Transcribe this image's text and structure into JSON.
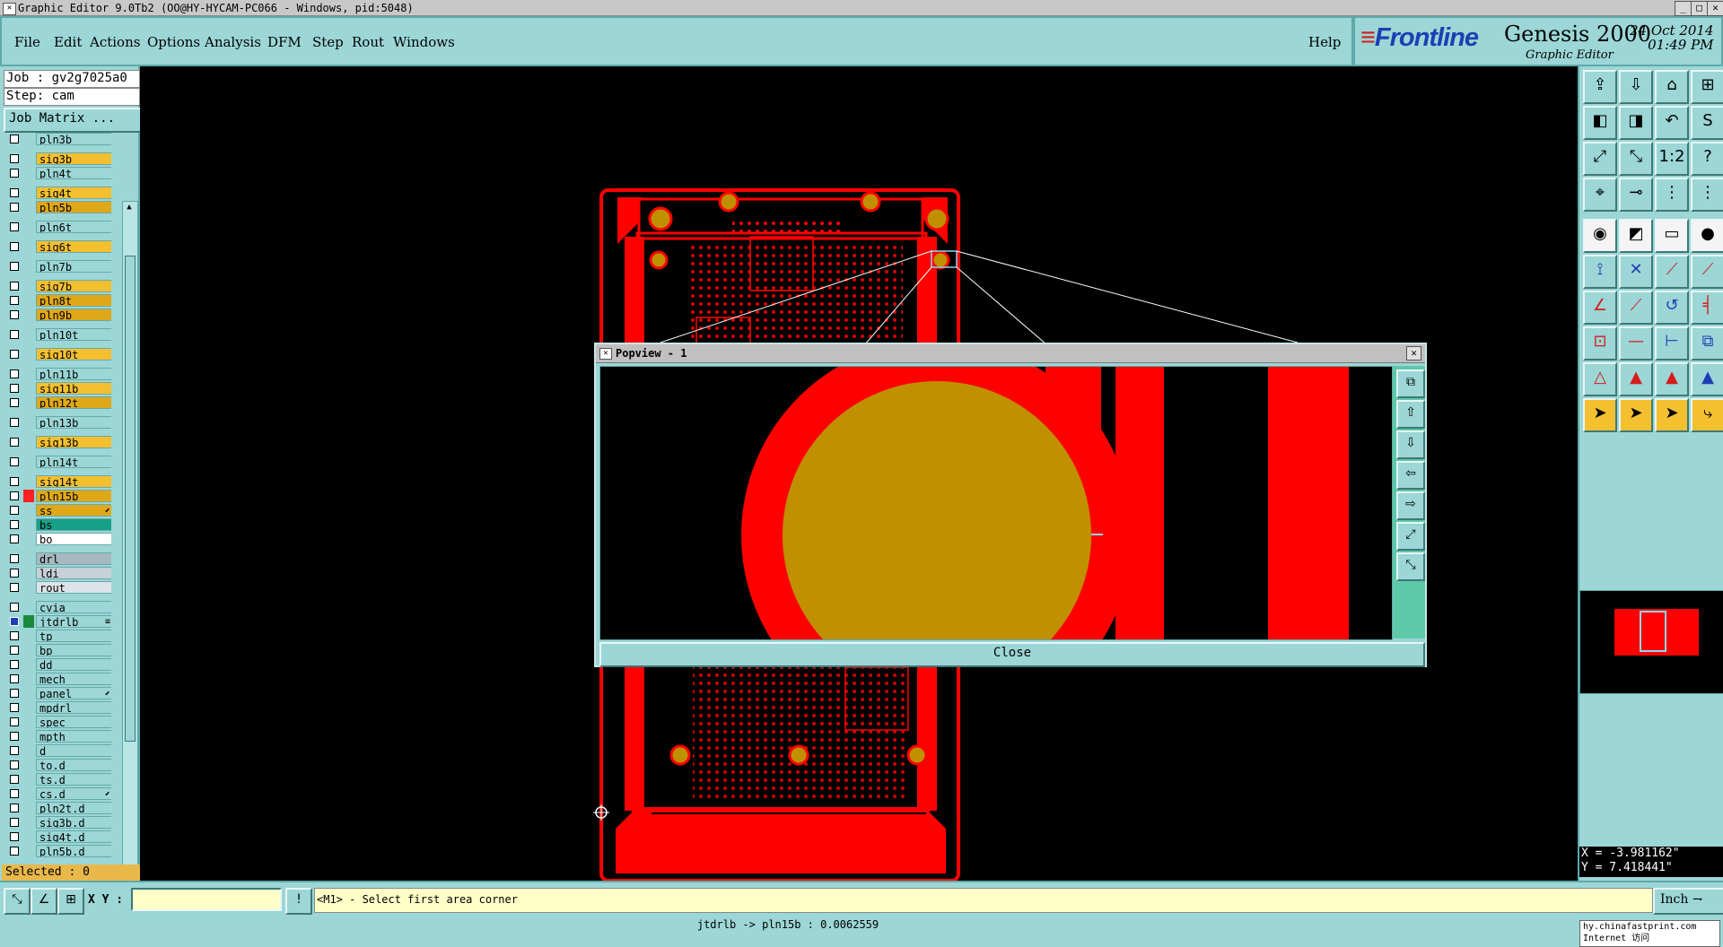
{
  "window": {
    "title": "Graphic Editor 9.0Tb2 (OO@HY-HYCAM-PC066 - Windows, pid:5048)",
    "app_icon": "app-window-icon",
    "controls": [
      "_",
      "□",
      "✕"
    ]
  },
  "menu": [
    "File",
    "Edit",
    "Actions",
    "Options",
    "Analysis",
    "DFM",
    "Step",
    "Rout",
    "Windows"
  ],
  "help_label": "Help",
  "brand": {
    "logo": "Frontline",
    "product": "Genesis 2000",
    "subtitle": "Graphic Editor",
    "date": "24 Oct 2014",
    "time": "01:49 PM",
    "logo_color": "#1d3fb3",
    "accent_color": "#d51b1b"
  },
  "job": {
    "job_label": "Job : gv2g7025a0",
    "step_label": "Step: cam",
    "matrix_button": "Job Matrix ..."
  },
  "layers": [
    {
      "name": "pln3b",
      "color": "#9cd6d6"
    },
    {
      "name": "sig3b",
      "color": "#f4c030"
    },
    {
      "name": "pln4t",
      "color": "#9cd6d6"
    },
    {
      "name": "sig4t",
      "color": "#f4c030"
    },
    {
      "name": "pln5b",
      "color": "#e0a818"
    },
    {
      "name": "pln6t",
      "color": "#9cd6d6"
    },
    {
      "name": "sig6t",
      "color": "#f4c030"
    },
    {
      "name": "pln7b",
      "color": "#9cd6d6"
    },
    {
      "name": "sig7b",
      "color": "#f4c030"
    },
    {
      "name": "pln8t",
      "color": "#e0a818"
    },
    {
      "name": "pln9b",
      "color": "#e0a818"
    },
    {
      "name": "pln10t",
      "color": "#9cd6d6"
    },
    {
      "name": "sig10t",
      "color": "#f4c030"
    },
    {
      "name": "pln11b",
      "color": "#9cd6d6"
    },
    {
      "name": "sig11b",
      "color": "#f4c030"
    },
    {
      "name": "pln12t",
      "color": "#e0a818"
    },
    {
      "name": "pln13b",
      "color": "#9cd6d6"
    },
    {
      "name": "sig13b",
      "color": "#f4c030"
    },
    {
      "name": "pln14t",
      "color": "#9cd6d6"
    },
    {
      "name": "sig14t",
      "color": "#f4c030"
    },
    {
      "name": "pln15b",
      "color": "#e0a818",
      "swatch": "#ff2020"
    },
    {
      "name": "ss",
      "color": "#e0a818",
      "mark": "⬋"
    },
    {
      "name": "bs",
      "color": "#16a088"
    },
    {
      "name": "bo",
      "color": "#ffffff"
    },
    {
      "name": "drl",
      "color": "#a8b8c0"
    },
    {
      "name": "ldi",
      "color": "#c8d0d8"
    },
    {
      "name": "rout",
      "color": "#dde4e8"
    },
    {
      "name": "cvia",
      "color": "#9cd6d6"
    },
    {
      "name": "jtdrlb",
      "color": "#9cd6d6",
      "swatch": "#1a8a3a",
      "checked": true,
      "mark": "≡"
    },
    {
      "name": "tp",
      "color": "#9cd6d6"
    },
    {
      "name": "bp",
      "color": "#9cd6d6"
    },
    {
      "name": "dd",
      "color": "#9cd6d6"
    },
    {
      "name": "mech",
      "color": "#9cd6d6"
    },
    {
      "name": "panel",
      "color": "#9cd6d6",
      "mark": "⬋"
    },
    {
      "name": "mpdrl",
      "color": "#9cd6d6"
    },
    {
      "name": "spec",
      "color": "#9cd6d6"
    },
    {
      "name": "mpth",
      "color": "#9cd6d6"
    },
    {
      "name": "d",
      "color": "#9cd6d6"
    },
    {
      "name": "to.d",
      "color": "#9cd6d6"
    },
    {
      "name": "ts.d",
      "color": "#9cd6d6"
    },
    {
      "name": "cs.d",
      "color": "#9cd6d6",
      "mark": "⬋"
    },
    {
      "name": "pln2t.d",
      "color": "#9cd6d6"
    },
    {
      "name": "sig3b.d",
      "color": "#9cd6d6"
    },
    {
      "name": "sig4t.d",
      "color": "#9cd6d6"
    },
    {
      "name": "pln5b.d",
      "color": "#9cd6d6"
    }
  ],
  "selected_label": "Selected : 0",
  "toolbar": [
    {
      "icon": "open-job-icon",
      "glyph": "⇪"
    },
    {
      "icon": "save-icon",
      "glyph": "⇩"
    },
    {
      "icon": "home-icon",
      "glyph": "⌂"
    },
    {
      "icon": "split-view-icon",
      "glyph": "⊞"
    },
    {
      "icon": "pan-left-icon",
      "glyph": "◧"
    },
    {
      "icon": "pan-right-icon",
      "glyph": "◨"
    },
    {
      "icon": "undo-view-icon",
      "glyph": "↶"
    },
    {
      "icon": "redraw-icon",
      "glyph": "S"
    },
    {
      "icon": "zoom-fit-icon",
      "glyph": "⤢"
    },
    {
      "icon": "zoom-area-icon",
      "glyph": "⤡"
    },
    {
      "icon": "scale-1-2-icon",
      "glyph": "1:2"
    },
    {
      "icon": "help-query-icon",
      "glyph": "?"
    },
    {
      "icon": "measure-icon",
      "glyph": "⌖"
    },
    {
      "icon": "probe-icon",
      "glyph": "⊸"
    },
    {
      "icon": "layer-select-icon",
      "glyph": "⋮"
    },
    {
      "icon": "layer-adjust-icon",
      "glyph": "⋮"
    },
    {
      "icon": "add-pad-icon",
      "glyph": "◉"
    },
    {
      "icon": "add-line-icon",
      "glyph": "◩"
    },
    {
      "icon": "add-text-icon",
      "glyph": "▭"
    },
    {
      "icon": "add-circle-icon",
      "glyph": "●"
    },
    {
      "icon": "connect-icon",
      "glyph": "⟟"
    },
    {
      "icon": "move-node-icon",
      "glyph": "✕"
    },
    {
      "icon": "move-segment-icon",
      "glyph": "⟋"
    },
    {
      "icon": "route-icon",
      "glyph": "⟋"
    },
    {
      "icon": "draw-line-icon",
      "glyph": "∠"
    },
    {
      "icon": "slant-line-icon",
      "glyph": "⟋"
    },
    {
      "icon": "arc-icon",
      "glyph": "↺"
    },
    {
      "icon": "mirror-icon",
      "glyph": "╡"
    },
    {
      "icon": "snap-pad-icon",
      "glyph": "⊡"
    },
    {
      "icon": "cut-line-icon",
      "glyph": "—"
    },
    {
      "icon": "resize-icon",
      "glyph": "⊢"
    },
    {
      "icon": "copy-feature-icon",
      "glyph": "⧉"
    },
    {
      "icon": "triangle-a-icon",
      "glyph": "△"
    },
    {
      "icon": "triangle-b-icon",
      "glyph": "▲"
    },
    {
      "icon": "triangle-c-icon",
      "glyph": "▲"
    },
    {
      "icon": "triangle-d-icon",
      "glyph": "▲"
    },
    {
      "icon": "select-arrow-icon",
      "glyph": "➤"
    },
    {
      "icon": "select-feature-icon",
      "glyph": "➤"
    },
    {
      "icon": "select-net-icon",
      "glyph": "➤"
    },
    {
      "icon": "select-route-icon",
      "glyph": "⤷"
    }
  ],
  "readout": {
    "x": "X = -3.981162\"",
    "y": "Y = 7.418441\""
  },
  "popview": {
    "title": "Popview - 1",
    "close_label": "Close",
    "tools": [
      "popview-layout-icon",
      "popview-up-icon",
      "popview-down-icon",
      "popview-left-icon",
      "popview-right-icon",
      "popview-fit-icon",
      "popview-zoom-icon"
    ]
  },
  "cmd": {
    "xy_label": "X Y :",
    "xy_value": "",
    "prompt": "<M1> - Select first area corner",
    "unit": "Inch"
  },
  "status": "jtdrlb -> pln15b : 0.0062559",
  "url": {
    "line1": "hy.chinafastprint.com",
    "line2": "Internet 访问"
  },
  "colors": {
    "panel": "#9cd6d6",
    "copper": "#ff0000",
    "pad": "#c09000",
    "canvas": "#000000"
  }
}
